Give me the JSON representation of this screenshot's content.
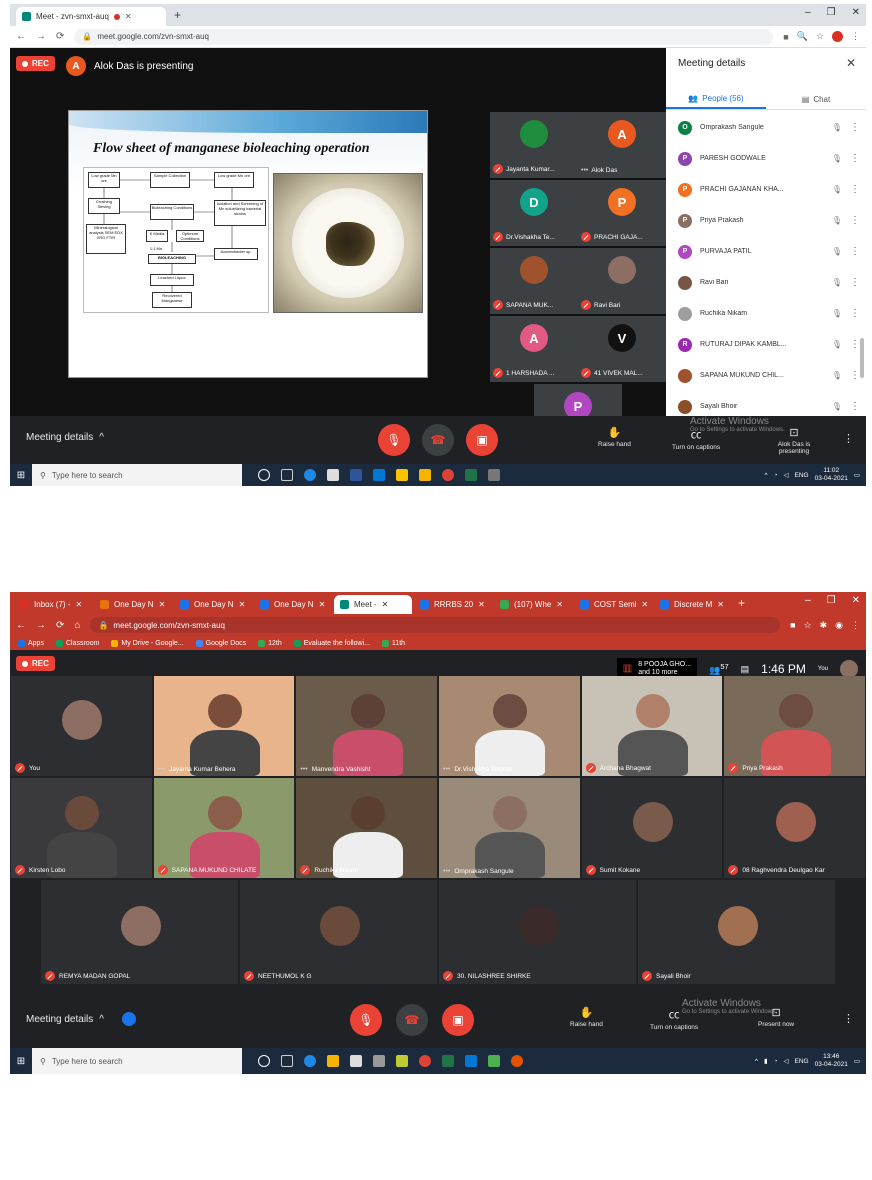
{
  "shot1": {
    "tab": {
      "title": "Meet - zvn-smxt-auq"
    },
    "url": "meet.google.com/zvn-smxt-auq",
    "rec_label": "REC",
    "presenter": {
      "initial": "A",
      "text": "Alok Das is presenting"
    },
    "slide_title": "Flow sheet of manganese bioleaching operation",
    "flow_labels": {
      "b1": "Low grade Mn ore",
      "b2": "Sample Collection",
      "b3": "Low grade Mn ore",
      "b4": "Crushing Sieving",
      "b5": "Bioleaching Conditions",
      "b6": "Isolation and Screening of Mn solubilizing bacterial strains",
      "b7": "Mineralogical analysis SEM EDX XRD FTIR",
      "b8": "K Media",
      "b9": "Optimum Conditions",
      "b10": "1:1 Mn",
      "b11": "BIOLEACHING",
      "b12": "Acinetobacter sp.",
      "b13": "Leached Liquor",
      "b14": "Recovered Manganese"
    },
    "tiles": [
      {
        "initial": "",
        "name": "Jayanta Kumar...",
        "color": "#1e8e3e",
        "muted": true
      },
      {
        "initial": "A",
        "name": "Alok Das",
        "color": "#e8581f",
        "muted": false
      },
      {
        "initial": "D",
        "name": "Dr.Vishakha Te...",
        "color": "#12a38a",
        "muted": true
      },
      {
        "initial": "P",
        "name": "PRACHI GAJA...",
        "color": "#f36f21",
        "muted": true
      },
      {
        "initial": "",
        "name": "SAPANA MUK...",
        "color": "#a0522d",
        "muted": true
      },
      {
        "initial": "",
        "name": "Ravi Bari",
        "color": "#8d6e63",
        "muted": true
      },
      {
        "initial": "A",
        "name": "1 HARSHADA ...",
        "color": "#e05a84",
        "muted": true
      },
      {
        "initial": "V",
        "name": "41 VIVEK MAL...",
        "color": "#111111",
        "muted": true
      },
      {
        "initial": "P",
        "name": "PURVAJA PATIL",
        "color": "#b247c2",
        "muted": true
      }
    ],
    "panel": {
      "title": "Meeting details",
      "tab_people": "People (56)",
      "tab_chat": "Chat",
      "people": [
        {
          "initial": "O",
          "name": "Omprakash Sangule",
          "color": "#0b8043"
        },
        {
          "initial": "P",
          "name": "PARESH GODWALE",
          "color": "#8e44ad"
        },
        {
          "initial": "P",
          "name": "PRACHI GAJANAN KHA...",
          "color": "#f36f21"
        },
        {
          "initial": "P",
          "name": "Priya Prakash",
          "color": "#8d6e63"
        },
        {
          "initial": "P",
          "name": "PURVAJA PATIL",
          "color": "#b247c2"
        },
        {
          "initial": "",
          "name": "Ravi Bari",
          "color": "#795548"
        },
        {
          "initial": "",
          "name": "Ruchika Nikam",
          "color": "#9e9e9e"
        },
        {
          "initial": "R",
          "name": "RUTURAJ DIPAK KAMBL...",
          "color": "#9c27b0"
        },
        {
          "initial": "",
          "name": "SAPANA MUKUND CHIL...",
          "color": "#a0522d"
        },
        {
          "initial": "",
          "name": "Sayali Bhoir",
          "color": "#8d4e2a"
        }
      ]
    },
    "bottom": {
      "meeting_details": "Meeting details",
      "raise_hand": "Raise hand",
      "captions": "Turn on captions",
      "presenting": "Alok Das is presenting",
      "activate": "Activate Windows",
      "activate_sub": "Go to Settings to activate Windows."
    },
    "taskbar": {
      "search": "Type here to search",
      "lang": "ENG",
      "time": "11:02",
      "date": "03-04-2021"
    }
  },
  "shot2": {
    "tabs": [
      "Inbox (7) - ",
      "One Day N",
      "One Day N",
      "One Day N",
      "Meet - ",
      "RRRBS 20",
      "(107) Whe",
      "COST Semi",
      "Discrete M"
    ],
    "url": "meet.google.com/zvn-smxt-auq",
    "bookmarks": [
      "Apps",
      "Classroom",
      "My Drive - Google...",
      "Google Docs",
      "12th",
      "Evaluate the followi...",
      "11th"
    ],
    "rec_label": "REC",
    "presenting": {
      "line1": "8 POOJA GHO...",
      "line2": "and 10 more"
    },
    "participant_count": "57",
    "time": "1:46 PM",
    "you_label": "You",
    "tiles": [
      {
        "name": "You",
        "muted": true
      },
      {
        "name": "Jayanta Kumar Behera",
        "muted": false
      },
      {
        "name": "Manvendra Vashisht",
        "muted": false
      },
      {
        "name": "Dr.Vishakha Telgote",
        "muted": false
      },
      {
        "name": "Archana Bhagwat",
        "muted": true
      },
      {
        "name": "Priya Prakash",
        "muted": true
      },
      {
        "name": "Kirsten Lobo",
        "muted": true
      },
      {
        "name": "SAPANA MUKUND CHILATE",
        "muted": true
      },
      {
        "name": "Ruchika Nikam",
        "muted": true
      },
      {
        "name": "Omprakash Sangule",
        "muted": false
      },
      {
        "name": "Sumit Kokane",
        "muted": true
      },
      {
        "name": "08 Raghvendra Deulgao Kar",
        "muted": true
      },
      {
        "name": "REMYA MADAN GOPAL",
        "muted": true
      },
      {
        "name": "NEETHUMOL K G",
        "muted": true
      },
      {
        "name": "30. NILASHREE SHIRKE",
        "muted": true
      },
      {
        "name": "Sayali Bhoir",
        "muted": true
      }
    ],
    "bottom": {
      "meeting_details": "Meeting details",
      "raise_hand": "Raise hand",
      "captions": "Turn on captions",
      "present_now": "Present now",
      "activate": "Activate Windows",
      "activate_sub": "Go to Settings to activate Windows."
    },
    "taskbar": {
      "search": "Type here to search",
      "lang": "ENG",
      "time": "13:46",
      "date": "03-04-2021"
    }
  }
}
